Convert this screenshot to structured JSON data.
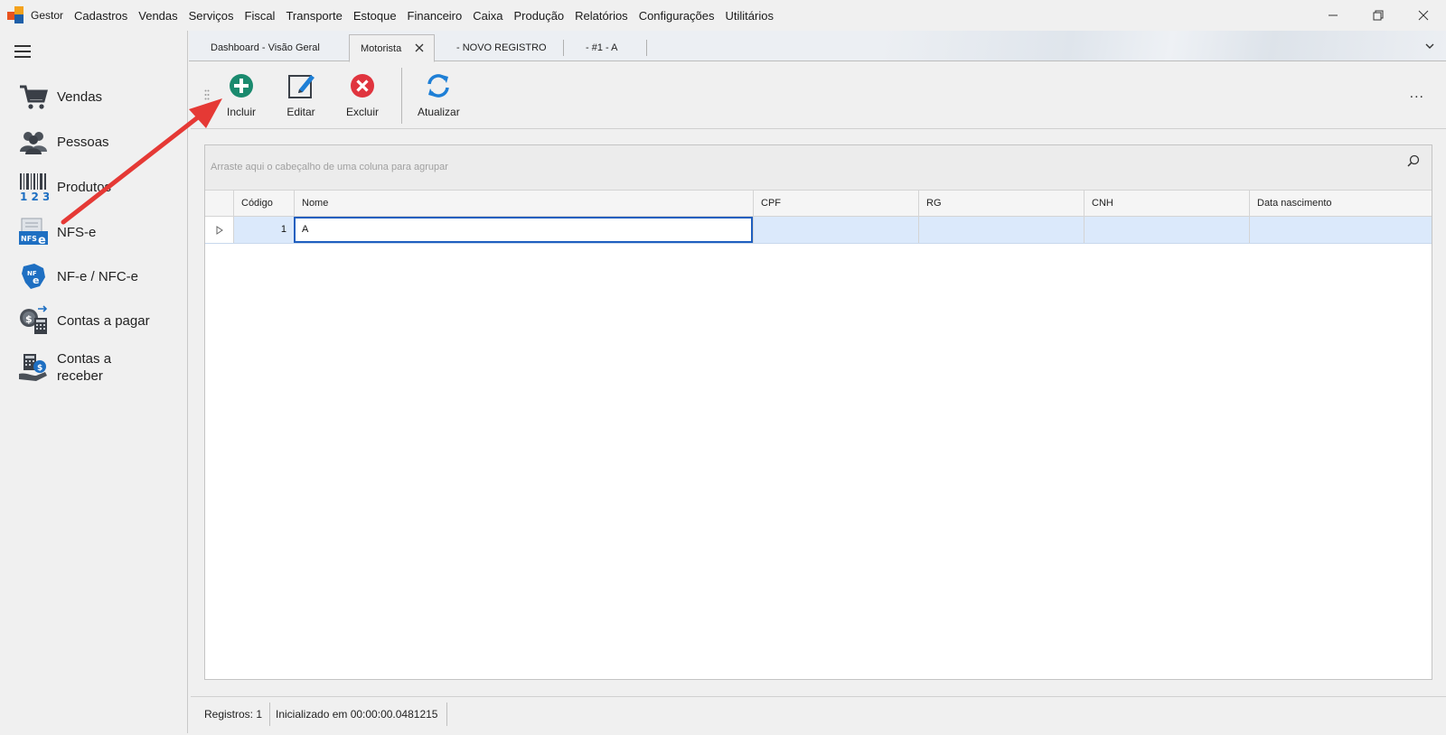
{
  "menubar": {
    "app_name": "Gestor",
    "items": [
      "Cadastros",
      "Vendas",
      "Serviços",
      "Fiscal",
      "Transporte",
      "Estoque",
      "Financeiro",
      "Caixa",
      "Produção",
      "Relatórios",
      "Configurações",
      "Utilitários"
    ],
    "window_controls": [
      "minimize-icon",
      "restore-icon",
      "close-icon"
    ]
  },
  "sidebar": {
    "items": [
      {
        "label": "Vendas",
        "icon": "cart-icon"
      },
      {
        "label": "Pessoas",
        "icon": "people-icon"
      },
      {
        "label": "Produtos",
        "icon": "barcode-icon"
      },
      {
        "label": "NFS-e",
        "icon": "nfse-icon"
      },
      {
        "label": "NF-e / NFC-e",
        "icon": "nfe-icon"
      },
      {
        "label": "Contas a pagar",
        "icon": "payables-icon"
      },
      {
        "label": "Contas a receber",
        "icon": "receivables-icon"
      }
    ]
  },
  "tabs": [
    {
      "label": "Dashboard - Visão Geral",
      "active": false
    },
    {
      "label": "Motorista",
      "active": true
    },
    {
      "label": "- NOVO REGISTRO",
      "active": false
    },
    {
      "label": "- #1 - A",
      "active": false
    }
  ],
  "toolbar": {
    "incluir": "Incluir",
    "editar": "Editar",
    "excluir": "Excluir",
    "atualizar": "Atualizar",
    "more": "..."
  },
  "grid": {
    "group_hint": "Arraste aqui o cabeçalho de uma coluna para agrupar",
    "columns": [
      "Código",
      "Nome",
      "CPF",
      "RG",
      "CNH",
      "Data nascimento"
    ],
    "rows": [
      {
        "codigo": "1",
        "nome": "A",
        "cpf": "",
        "rg": "",
        "cnh": "",
        "data_nascimento": ""
      }
    ]
  },
  "statusbar": {
    "registros": "Registros: 1",
    "inicializado": "Inicializado em 00:00:00.0481215"
  },
  "colors": {
    "accent_selection": "#dbe9fb",
    "focus_border": "#1f5fbf",
    "add_green": "#1a8a6e",
    "delete_red": "#e0343e",
    "refresh_blue": "#1e7fd6",
    "annotation_red": "#e53935"
  }
}
